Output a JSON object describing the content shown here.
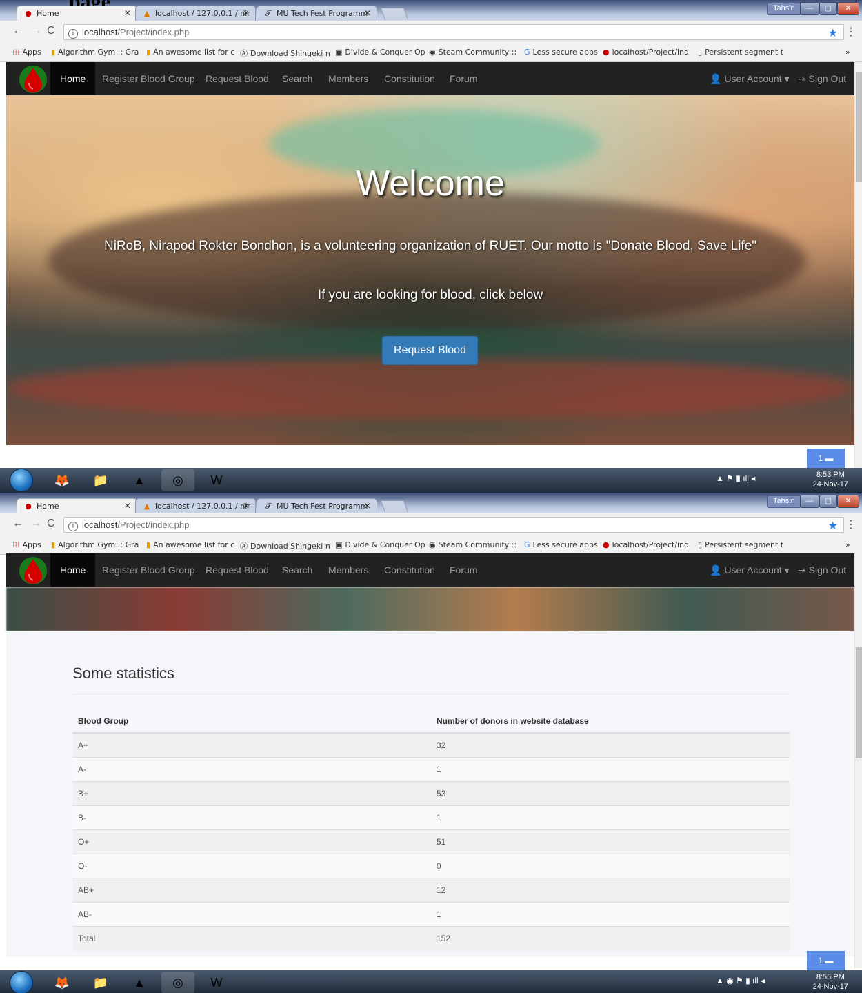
{
  "heading_fragment": "page",
  "browser": {
    "tabs": [
      {
        "label": "Home",
        "favicon": "blood-drop-icon",
        "active": true
      },
      {
        "label": "localhost / 127.0.0.1 / nir",
        "favicon": "phpmyadmin-icon",
        "active": false
      },
      {
        "label": "MU Tech Fest Programm",
        "favicon": "mu-icon",
        "active": false
      }
    ],
    "profile": "Tahsin",
    "url_host": "localhost",
    "url_path": "/Project/index.php",
    "bookmarks": [
      "Apps",
      "Algorithm Gym :: Gra",
      "An awesome list for c",
      "Download Shingeki n",
      "Divide & Conquer Op",
      "Steam Community :: ",
      "Less secure apps",
      "localhost/Project/ind",
      "Persistent segment t"
    ],
    "bookmarks_more": "»"
  },
  "nav": {
    "items": [
      "Home",
      "Register Blood Group",
      "Request Blood",
      "Search",
      "Members",
      "Constitution",
      "Forum"
    ],
    "user_account": "User Account",
    "sign_out": "Sign Out"
  },
  "hero": {
    "title": "Welcome",
    "subtitle": "NiRoB, Nirapod Rokter Bondhon, is a volunteering organization of RUET. Our motto is \"Donate Blood, Save Life\"",
    "looking": "If you are looking for blood, click below",
    "button": "Request Blood"
  },
  "chat_badge": "1",
  "taskbar1": {
    "time": "8:53 PM",
    "date": "24-Nov-17"
  },
  "taskbar2": {
    "time": "8:55 PM",
    "date": "24-Nov-17"
  },
  "stats": {
    "title": "Some statistics",
    "headers": [
      "Blood Group",
      "Number of donors in website database"
    ],
    "rows": [
      [
        "A+",
        "32"
      ],
      [
        "A-",
        "1"
      ],
      [
        "B+",
        "53"
      ],
      [
        "B-",
        "1"
      ],
      [
        "O+",
        "51"
      ],
      [
        "O-",
        "0"
      ],
      [
        "AB+",
        "12"
      ],
      [
        "AB-",
        "1"
      ],
      [
        "Total",
        "152"
      ]
    ]
  },
  "colors": {
    "navbar": "#222222",
    "primary": "#337ab7",
    "chat": "#5a8ce8"
  }
}
